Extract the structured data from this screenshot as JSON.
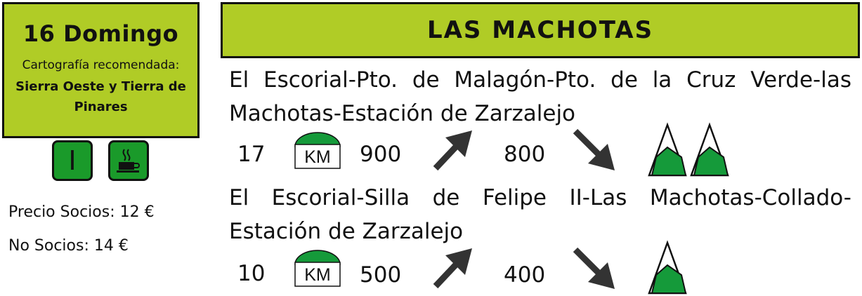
{
  "date_box": {
    "title": "16 Domingo",
    "carto_label": "Cartografía recomendada:",
    "carto_value": "Sierra Oeste y Tierra de Pinares"
  },
  "level_badge": {
    "value": "I"
  },
  "meal_badge": {
    "icon": "hot-drink-icon"
  },
  "prices": {
    "socios": "Precio Socios: 12 €",
    "no_socios": "No Socios: 14 €"
  },
  "header": {
    "title": "LAS MACHOTAS"
  },
  "routes": [
    {
      "description": "El Escorial-Pto. de Malagón-Pto. de la Cruz Verde-las Machotas-Estación de Zarzalejo",
      "km": "17",
      "km_label": "KM",
      "ascent": "900",
      "descent": "800",
      "difficulty_peaks": 2
    },
    {
      "description": "El Escorial-Silla de Felipe II-Las Machotas-Collado-Estación de Zarzalejo",
      "km": "10",
      "km_label": "KM",
      "ascent": "500",
      "descent": "400",
      "difficulty_peaks": 1
    }
  ],
  "colors": {
    "accent": "#b0cc26",
    "badge_green": "#1a9a2a",
    "peak_green": "#159a3a",
    "arrow": "#333333"
  }
}
